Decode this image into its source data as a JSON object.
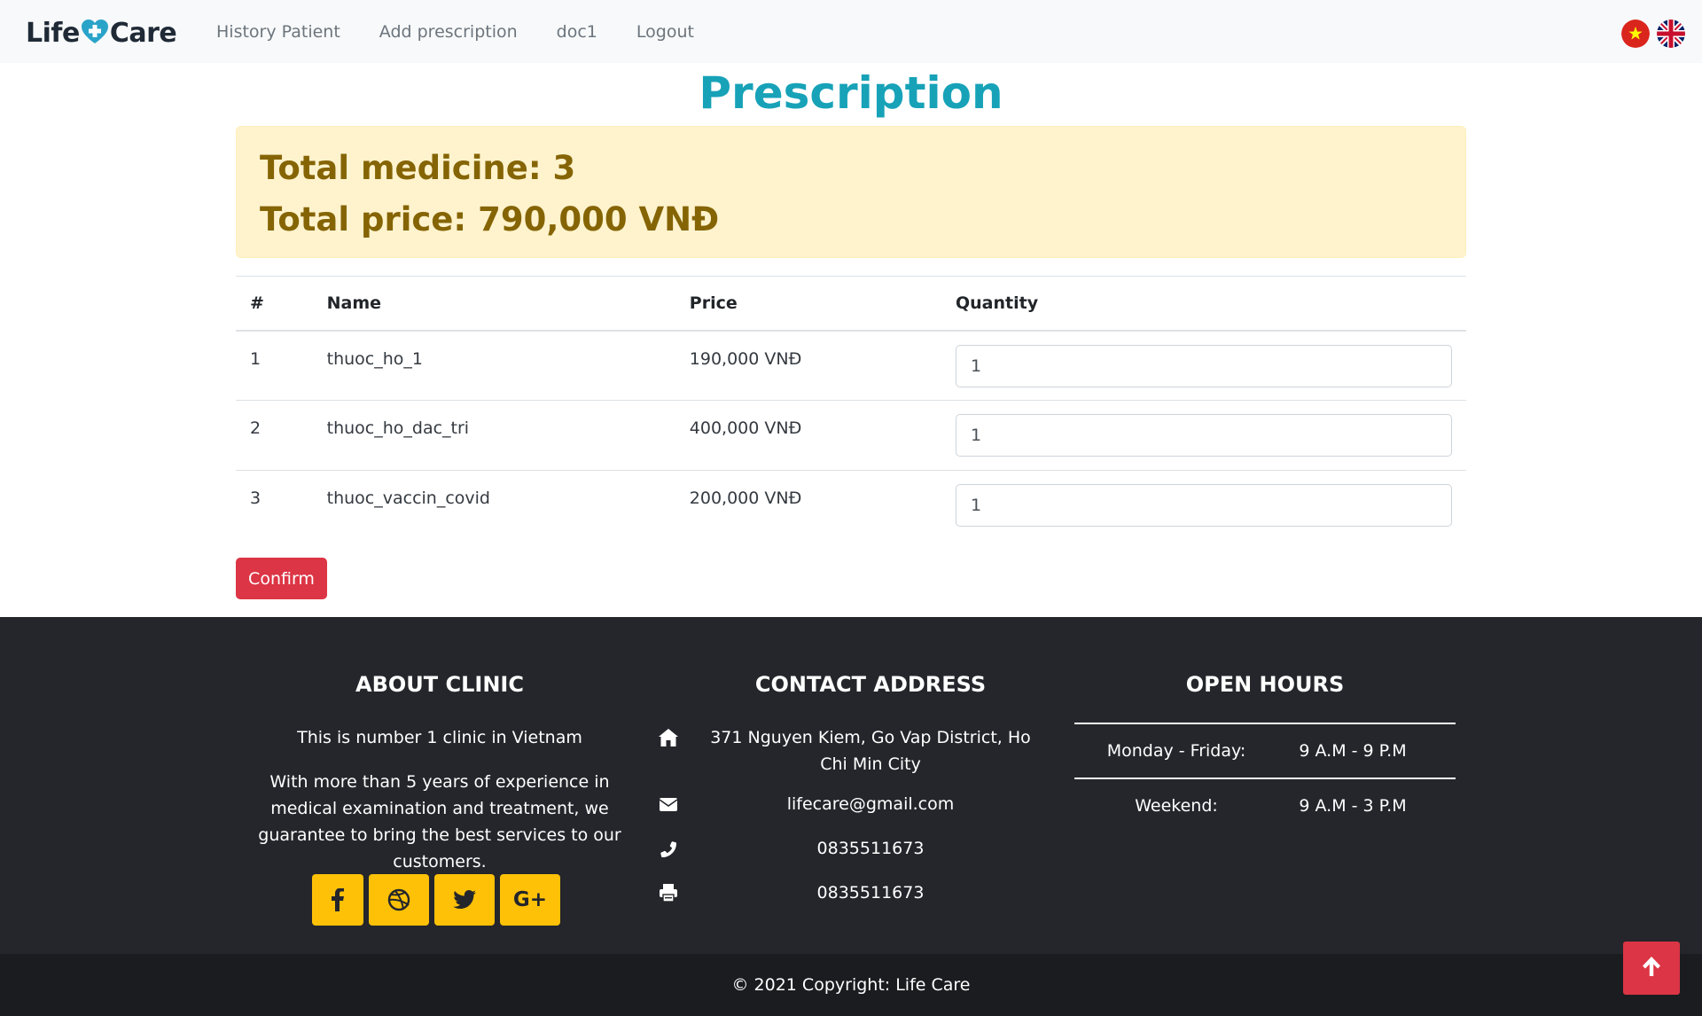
{
  "navbar": {
    "brand_left": "Life",
    "brand_right": "Care",
    "links": [
      "History Patient",
      "Add prescription",
      "doc1",
      "Logout"
    ],
    "flags": [
      "vietnam-flag-icon",
      "uk-flag-icon"
    ]
  },
  "main": {
    "title": "Prescription",
    "summary": {
      "total_medicine": "Total medicine: 3",
      "total_price": "Total price: 790,000 VNĐ"
    },
    "table": {
      "headers": [
        "#",
        "Name",
        "Price",
        "Quantity"
      ],
      "rows": [
        {
          "index": "1",
          "name": "thuoc_ho_1",
          "price": "190,000 VNĐ",
          "quantity": "1"
        },
        {
          "index": "2",
          "name": "thuoc_ho_dac_tri",
          "price": "400,000 VNĐ",
          "quantity": "1"
        },
        {
          "index": "3",
          "name": "thuoc_vaccin_covid",
          "price": "200,000 VNĐ",
          "quantity": "1"
        }
      ]
    },
    "confirm_label": "Confirm"
  },
  "footer": {
    "about": {
      "title": "ABOUT CLINIC",
      "line1": "This is number 1 clinic in Vietnam",
      "line2": "With more than 5 years of experience in medical examination and treatment, we guarantee to bring the best services to our customers.",
      "socials": [
        "facebook-icon",
        "dribbble-icon",
        "twitter-icon",
        "google-plus-icon"
      ],
      "gplus_label": "G+"
    },
    "contact": {
      "title": "CONTACT ADDRESS",
      "address": "371 Nguyen Kiem, Go Vap District, Ho Chi Min City",
      "email": "lifecare@gmail.com",
      "phone": "0835511673",
      "fax": "0835511673"
    },
    "hours": {
      "title": "OPEN HOURS",
      "rows": [
        {
          "day": "Monday - Friday:",
          "time": "9 A.M - 9 P.M"
        },
        {
          "day": "Weekend:",
          "time": "9 A.M - 3 P.M"
        }
      ]
    },
    "copyright": "© 2021 Copyright: Life Care"
  },
  "colors": {
    "accent_title": "#17a2b8",
    "danger": "#dc3545",
    "warning_bg": "#fff3cd",
    "warning_text": "#856404",
    "social": "#ffc107",
    "footer_bg": "#24262b"
  }
}
